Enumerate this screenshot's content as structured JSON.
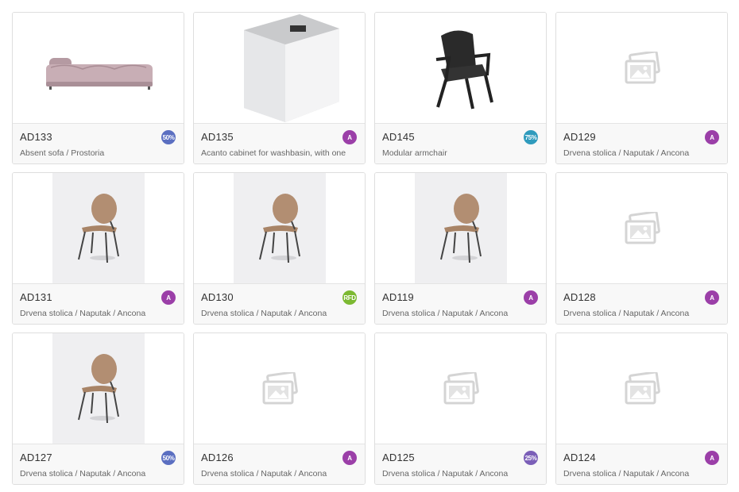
{
  "products": [
    {
      "code": "AD133",
      "desc": "Absent sofa / Prostoria",
      "badge": "50%",
      "badge_color": "#5b6fc1",
      "image": "sofa"
    },
    {
      "code": "AD135",
      "desc": "Acanto cabinet for washbasin, with one",
      "badge": "A",
      "badge_color": "#9b3fa8",
      "image": "cabinet"
    },
    {
      "code": "AD145",
      "desc": "Modular armchair",
      "badge": "75%",
      "badge_color": "#2f9bbd",
      "image": "armchair"
    },
    {
      "code": "AD129",
      "desc": "Drvena stolica / Naputak / Ancona",
      "badge": "A",
      "badge_color": "#9b3fa8",
      "image": "placeholder"
    },
    {
      "code": "AD131",
      "desc": "Drvena stolica / Naputak / Ancona",
      "badge": "A",
      "badge_color": "#9b3fa8",
      "image": "chair"
    },
    {
      "code": "AD130",
      "desc": "Drvena stolica / Naputak / Ancona",
      "badge": "RFD",
      "badge_color": "#7cb932",
      "image": "chair"
    },
    {
      "code": "AD119",
      "desc": "Drvena stolica / Naputak / Ancona",
      "badge": "A",
      "badge_color": "#9b3fa8",
      "image": "chair"
    },
    {
      "code": "AD128",
      "desc": "Drvena stolica / Naputak / Ancona",
      "badge": "A",
      "badge_color": "#9b3fa8",
      "image": "placeholder"
    },
    {
      "code": "AD127",
      "desc": "Drvena stolica / Naputak / Ancona",
      "badge": "50%",
      "badge_color": "#5b6fc1",
      "image": "chair"
    },
    {
      "code": "AD126",
      "desc": "Drvena stolica / Naputak / Ancona",
      "badge": "A",
      "badge_color": "#9b3fa8",
      "image": "placeholder"
    },
    {
      "code": "AD125",
      "desc": "Drvena stolica / Naputak / Ancona",
      "badge": "25%",
      "badge_color": "#7b5fb8",
      "image": "placeholder"
    },
    {
      "code": "AD124",
      "desc": "Drvena stolica / Naputak / Ancona",
      "badge": "A",
      "badge_color": "#9b3fa8",
      "image": "placeholder"
    }
  ]
}
